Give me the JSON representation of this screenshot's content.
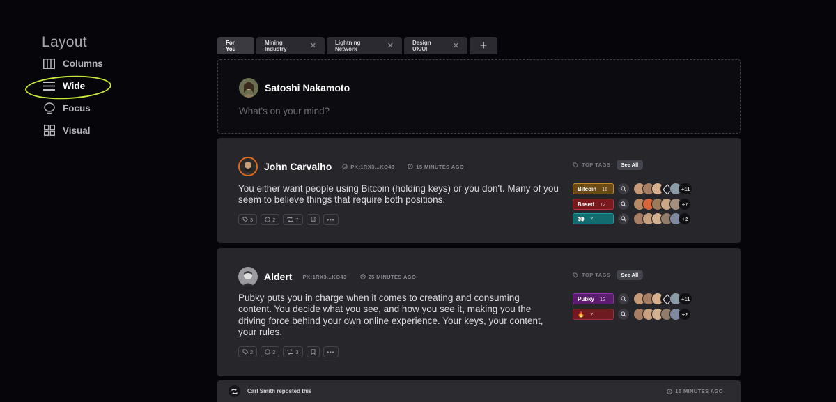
{
  "sidebar": {
    "title": "Layout",
    "items": [
      {
        "label": "Columns",
        "icon": "columns-icon"
      },
      {
        "label": "Wide",
        "icon": "wide-icon",
        "active": true
      },
      {
        "label": "Focus",
        "icon": "focus-icon"
      },
      {
        "label": "Visual",
        "icon": "visual-icon"
      }
    ],
    "highlight_color": "#c8e83a"
  },
  "tabs": [
    {
      "label": "For You",
      "active": true
    },
    {
      "label": "Mining Industry",
      "closable": true
    },
    {
      "label": "Lightning Network",
      "closable": true
    },
    {
      "label": "Design UX/UI",
      "closable": true
    }
  ],
  "compose": {
    "user_name": "Satoshi Nakamoto",
    "placeholder": "What's on your mind?"
  },
  "posts": [
    {
      "author": "John Carvalho",
      "pk": "PK:1RX3...KO43",
      "time": "15 MINUTES AGO",
      "text": "You either want people using Bitcoin (holding keys) or you don't. Many of you seem to believe things that require both positions.",
      "actions": {
        "tags": "3",
        "replies": "2",
        "reposts": "7"
      },
      "top_tags_label": "TOP TAGS",
      "see_all": "See All",
      "tags": [
        {
          "label": "Bitcoin",
          "count": "16",
          "color": "#6b4a14",
          "border": "#c28a2a",
          "more": "+11"
        },
        {
          "label": "Based",
          "count": "12",
          "color": "#7a1a1f",
          "border": "#b8323a",
          "more": "+7"
        },
        {
          "label": "👀",
          "count": "7",
          "color": "#126b6e",
          "border": "#1e9ca0",
          "more": "+2"
        }
      ]
    },
    {
      "author": "Aldert",
      "pk": "PK:1RX3...KO43",
      "time": "25 MINUTES AGO",
      "text": "Pubky puts you in charge when it comes to creating and consuming content. You decide what you see, and how you see it, making you the driving force behind your own online experience. Your keys, your content, your rules.",
      "actions": {
        "tags": "2",
        "replies": "2",
        "reposts": "3"
      },
      "top_tags_label": "TOP TAGS",
      "see_all": "See All",
      "tags": [
        {
          "label": "Pubky",
          "count": "12",
          "color": "#5a1d6e",
          "border": "#8e34ad",
          "more": "+11"
        },
        {
          "label": "🔥",
          "count": "7",
          "color": "#6e1a20",
          "border": "#a5303a",
          "more": "+2"
        }
      ]
    }
  ],
  "repost": {
    "text": "Carl Smith reposted this",
    "time": "15 MINUTES AGO"
  }
}
